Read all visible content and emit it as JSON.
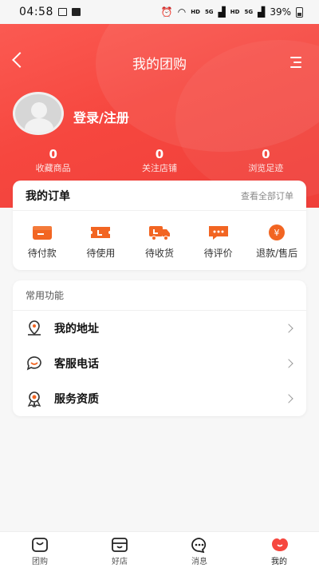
{
  "status_bar": {
    "time": "04:58",
    "signal_hd1": "HD",
    "signal_5g1": "5G",
    "signal_hd2": "HD",
    "signal_5g2": "5G",
    "battery": "39%"
  },
  "header": {
    "title": "我的团购",
    "login_label": "登录/注册"
  },
  "stats": [
    {
      "value": "0",
      "label": "收藏商品"
    },
    {
      "value": "0",
      "label": "关注店铺"
    },
    {
      "value": "0",
      "label": "浏览足迹"
    }
  ],
  "orders": {
    "title": "我的订单",
    "view_all": "查看全部订单",
    "items": [
      {
        "label": "待付款",
        "icon": "wallet-icon"
      },
      {
        "label": "待使用",
        "icon": "ticket-icon"
      },
      {
        "label": "待收货",
        "icon": "truck-icon"
      },
      {
        "label": "待评价",
        "icon": "comment-icon"
      },
      {
        "label": "退款/售后",
        "icon": "refund-icon"
      }
    ]
  },
  "functions": {
    "title": "常用功能",
    "items": [
      {
        "label": "我的地址",
        "icon": "location-icon"
      },
      {
        "label": "客服电话",
        "icon": "customer-service-icon"
      },
      {
        "label": "服务资质",
        "icon": "badge-icon"
      }
    ]
  },
  "tabs": [
    {
      "label": "团购",
      "icon": "shopping-bag-icon"
    },
    {
      "label": "好店",
      "icon": "store-icon"
    },
    {
      "label": "消息",
      "icon": "message-icon"
    },
    {
      "label": "我的",
      "icon": "profile-icon"
    }
  ],
  "colors": {
    "primary": "#f6473f",
    "icon_orange": "#f26522"
  }
}
